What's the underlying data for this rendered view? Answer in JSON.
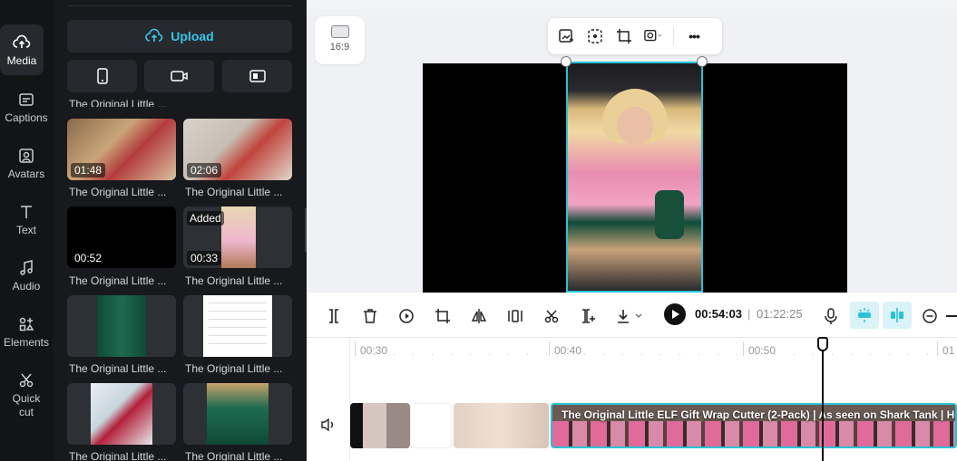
{
  "rail": {
    "items": [
      {
        "label": "Media",
        "icon": "cloud-upload-icon",
        "active": true
      },
      {
        "label": "Captions",
        "icon": "captions-icon"
      },
      {
        "label": "Avatars",
        "icon": "avatar-icon"
      },
      {
        "label": "Text",
        "icon": "text-icon"
      },
      {
        "label": "Audio",
        "icon": "music-note-icon"
      },
      {
        "label": "Elements",
        "icon": "elements-icon"
      },
      {
        "label": "Quick\ncut",
        "icon": "quick-cut-icon"
      }
    ]
  },
  "media": {
    "upload_label": "Upload",
    "sources": [
      "phone-icon",
      "camera-icon",
      "screen-record-icon"
    ],
    "cut_title": "The Original Little ...",
    "items": [
      {
        "title": "The Original Little ...",
        "duration": "01:48"
      },
      {
        "title": "The Original Little ...",
        "duration": "02:06"
      },
      {
        "title": "The Original Little ...",
        "duration": "00:52"
      },
      {
        "title": "The Original Little ...",
        "duration": "00:33",
        "badge": "Added"
      },
      {
        "title": "The Original Little ...",
        "duration": ""
      },
      {
        "title": "The Original Little ...",
        "duration": ""
      },
      {
        "title": "The Original Little ...",
        "duration": ""
      },
      {
        "title": "The Original Little ...",
        "duration": ""
      }
    ]
  },
  "canvas": {
    "ratio_label": "16:9",
    "toolbar": [
      "replace-icon",
      "remove-bg-icon",
      "crop-icon",
      "mask-icon",
      "more-icon"
    ],
    "toolbar_more": "•••"
  },
  "timeline": {
    "current_time": "00:54:03",
    "separator": "|",
    "total_time": "01:22:25",
    "ruler": [
      "00:30",
      "00:40",
      "00:50",
      "01"
    ],
    "main_clip_title": "The Original Little ELF Gift Wrap Cutter (2-Pack) | As seen on Shark Tank | Hol",
    "colors": {
      "accent": "#28c3d7",
      "upload": "#37c6e8"
    }
  }
}
